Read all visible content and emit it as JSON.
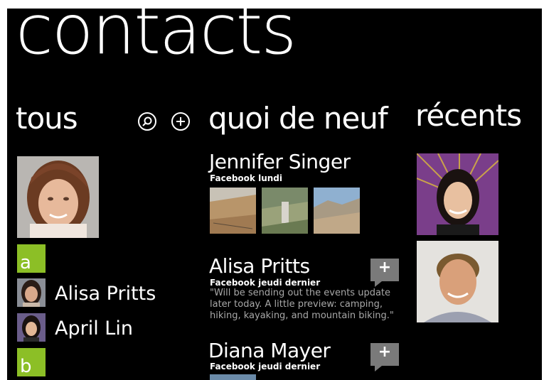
{
  "title": "contacts",
  "sections": {
    "all": "tous",
    "whats_new": "quoi de neuf",
    "recent": "récents"
  },
  "icons": {
    "search": "search-icon",
    "add": "add-icon"
  },
  "contacts_list": {
    "letter_a": "a",
    "letter_b": "b",
    "items": [
      {
        "name": "Alisa Pritts"
      },
      {
        "name": "April Lin"
      }
    ]
  },
  "feed": [
    {
      "name": "Jennifer Singer",
      "source": "Facebook lundi"
    },
    {
      "name": "Alisa Pritts",
      "source": "Facebook jeudi dernier",
      "quote": "\"Will be sending out the events update later today. A little preview: camping, hiking, kayaking, and mountain biking.\"",
      "comment_label": "+"
    },
    {
      "name": "Diana Mayer",
      "source": "Facebook jeudi dernier",
      "comment_label": "+"
    }
  ],
  "colors": {
    "background": "#000000",
    "accent": "#8cbf26",
    "secondary_text": "#a8a8a8",
    "comment_button": "#7a7a7a"
  }
}
